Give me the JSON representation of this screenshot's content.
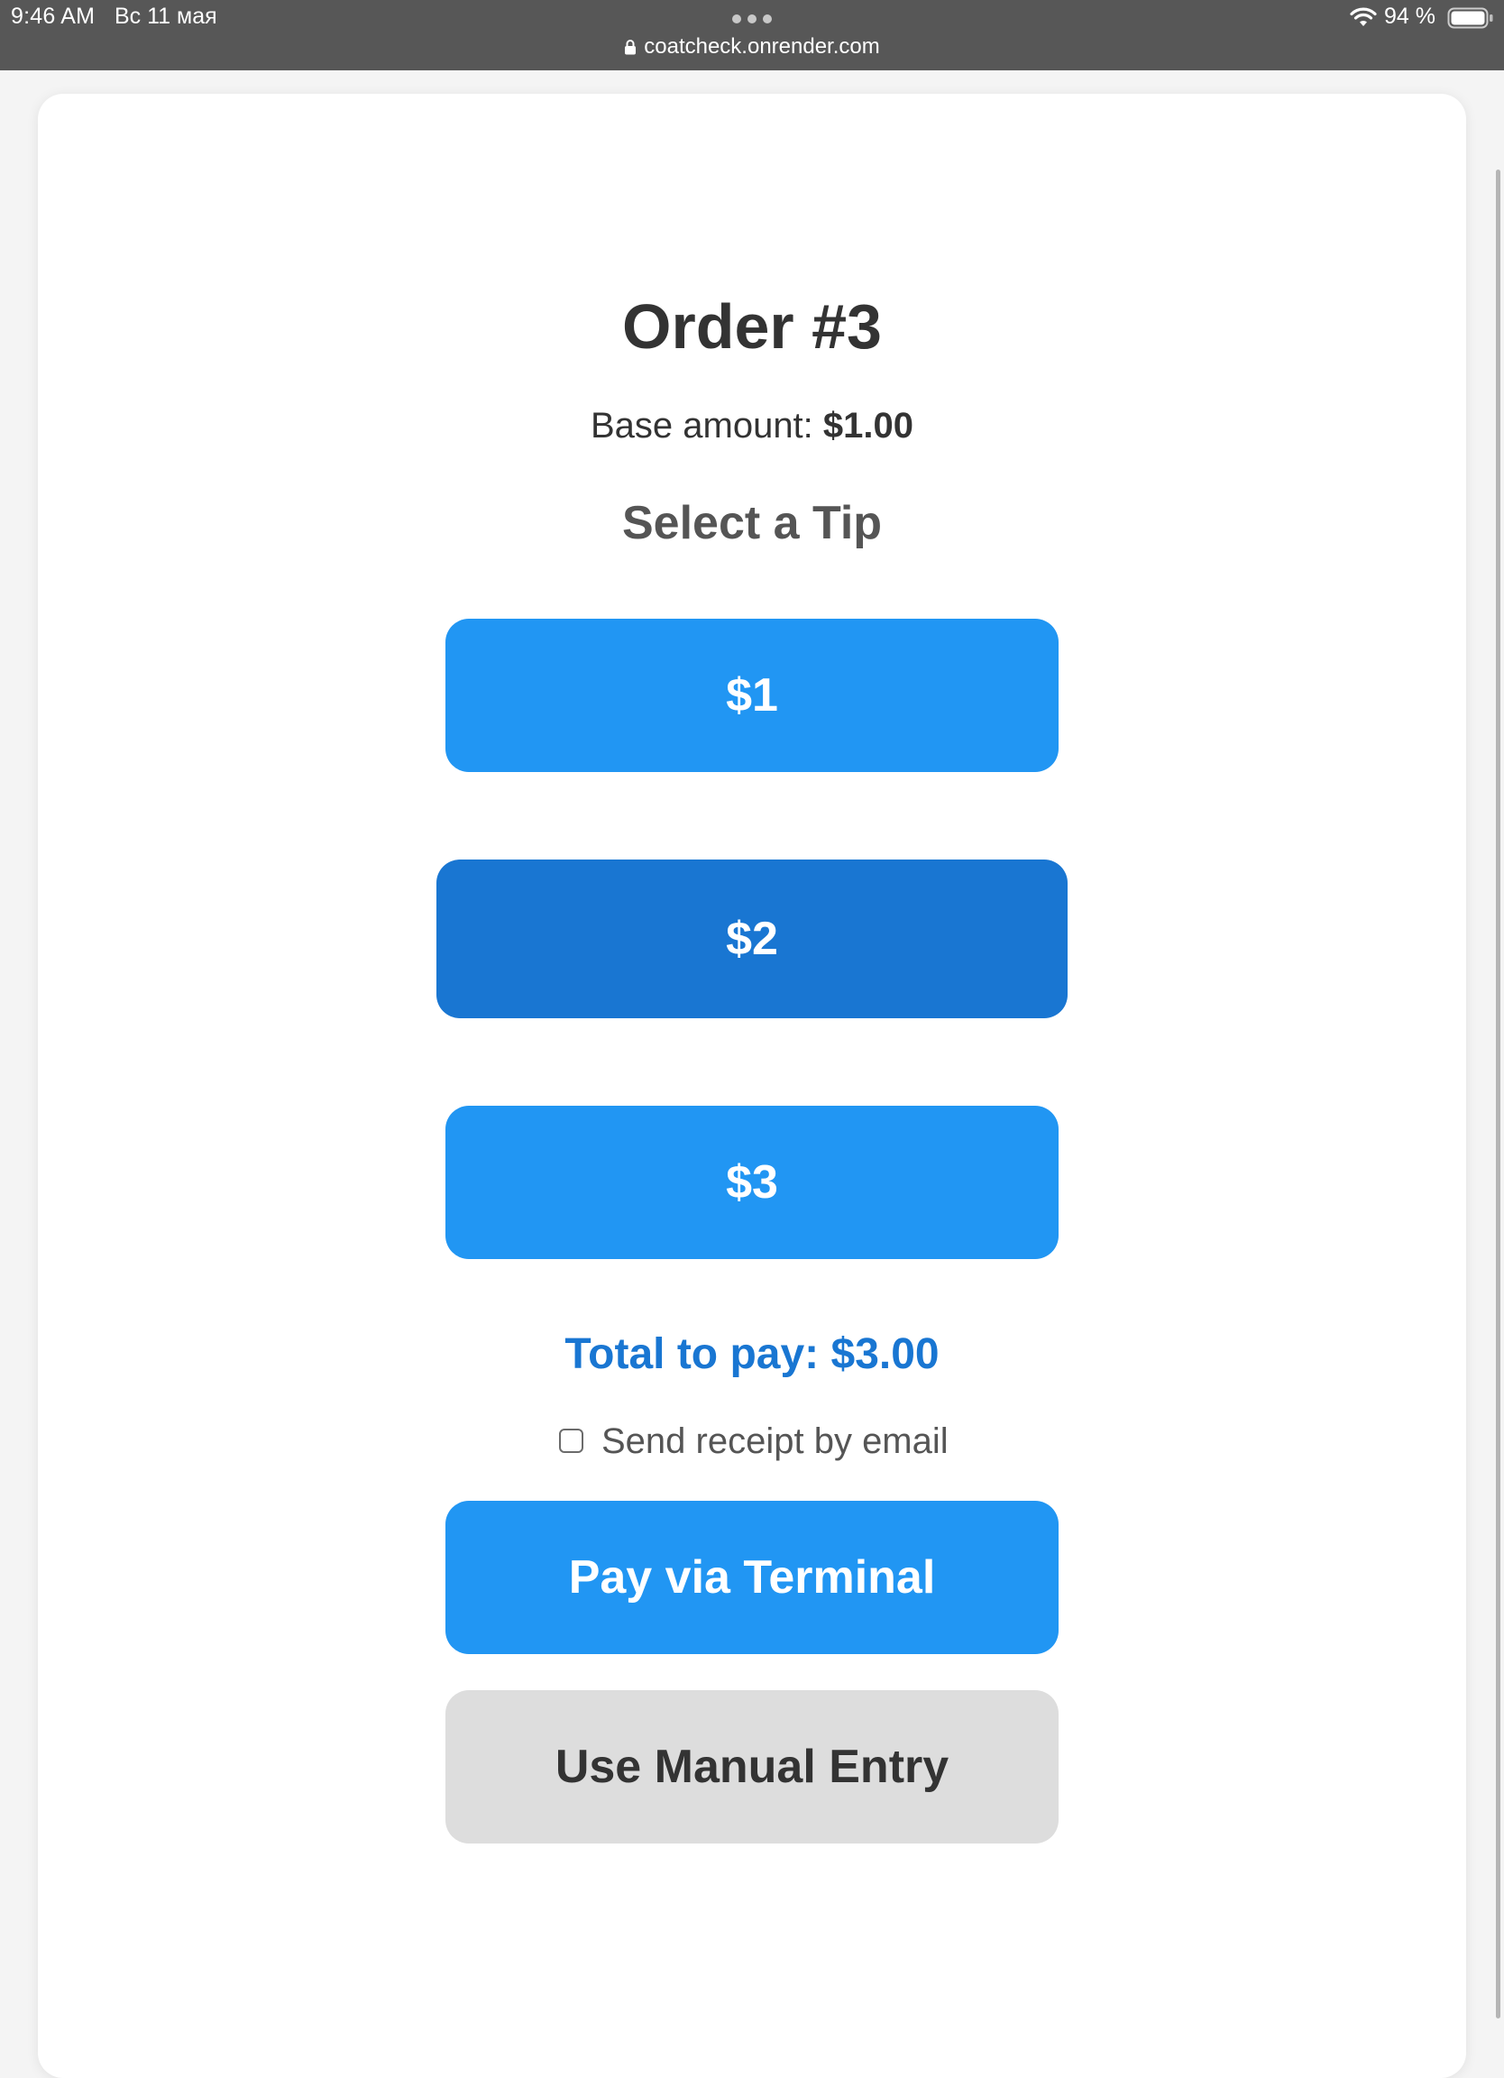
{
  "status_bar": {
    "time": "9:46 AM",
    "date": "Вс 11 мая",
    "battery_percent": "94 %",
    "url": "coatcheck.onrender.com"
  },
  "order": {
    "title": "Order #3",
    "base_label": "Base amount:",
    "base_value": "$1.00"
  },
  "tip": {
    "heading": "Select a Tip",
    "options": [
      {
        "label": "$1",
        "selected": false
      },
      {
        "label": "$2",
        "selected": true
      },
      {
        "label": "$3",
        "selected": false
      }
    ]
  },
  "total": {
    "text": "Total to pay: $3.00"
  },
  "receipt": {
    "label": "Send receipt by email",
    "checked": false
  },
  "actions": {
    "pay_label": "Pay via Terminal",
    "manual_label": "Use Manual Entry"
  },
  "colors": {
    "primary": "#2196f3",
    "primary_selected": "#1976d2",
    "secondary": "#dddddd",
    "total_text": "#1976d2"
  }
}
